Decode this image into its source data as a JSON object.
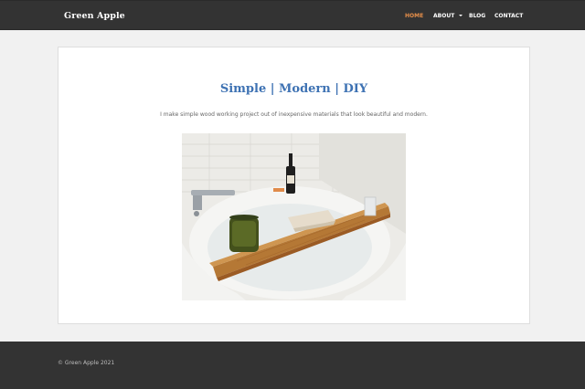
{
  "header": {
    "brand": "Green Apple",
    "nav": [
      {
        "label": "HOME",
        "active": true
      },
      {
        "label": "ABOUT",
        "has_dropdown": true
      },
      {
        "label": "BLOG"
      },
      {
        "label": "CONTACT"
      }
    ]
  },
  "main": {
    "title": "Simple | Modern | DIY",
    "subtitle": "I make simple wood working project out of inexpensive materials that look beautiful and modern.",
    "image": "bathtub-caddy-photo"
  },
  "footer": {
    "copyright": "© Green Apple 2021"
  },
  "colors": {
    "nav_bg": "#333333",
    "page_bg": "#f1f1f1",
    "accent_active": "#e8904a",
    "title_blue": "#3e72b3"
  }
}
